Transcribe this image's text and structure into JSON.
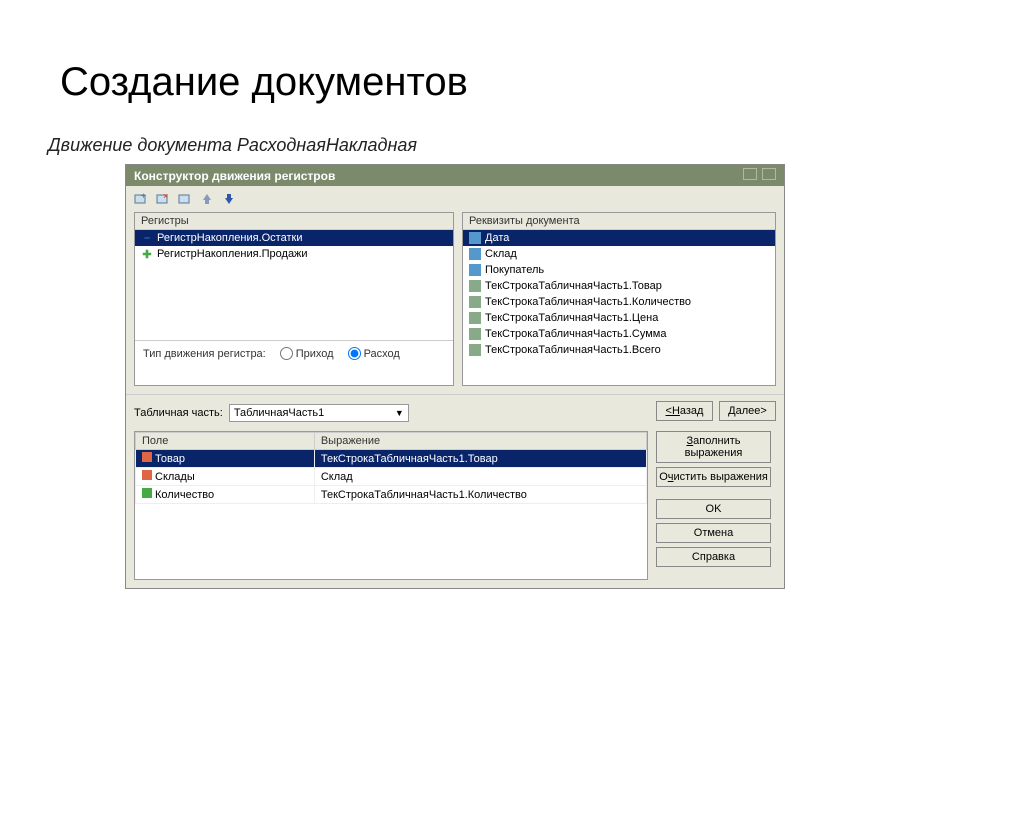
{
  "slide": {
    "title": "Создание документов",
    "subtitle": "Движение документа РасходнаяНакладная"
  },
  "window": {
    "title": "Конструктор движения регистров"
  },
  "registers": {
    "header": "Регистры",
    "items": [
      {
        "label": "РегистрНакопления.Остатки",
        "selected": true,
        "type": "minus"
      },
      {
        "label": "РегистрНакопления.Продажи",
        "selected": false,
        "type": "plus"
      }
    ]
  },
  "attrs": {
    "header": "Реквизиты документа",
    "items": [
      {
        "label": "Дата",
        "selected": true,
        "icon": "prop"
      },
      {
        "label": "Склад",
        "icon": "prop"
      },
      {
        "label": "Покупатель",
        "icon": "prop"
      },
      {
        "label": "ТекСтрокаТабличнаяЧасть1.Товар",
        "icon": "row"
      },
      {
        "label": "ТекСтрокаТабличнаяЧасть1.Количество",
        "icon": "row"
      },
      {
        "label": "ТекСтрокаТабличнаяЧасть1.Цена",
        "icon": "row"
      },
      {
        "label": "ТекСтрокаТабличнаяЧасть1.Сумма",
        "icon": "row"
      },
      {
        "label": "ТекСтрокаТабличнаяЧасть1.Всего",
        "icon": "row"
      }
    ]
  },
  "movement": {
    "label": "Тип движения регистра:",
    "option1": "Приход",
    "option2": "Расход",
    "selected": "Расход"
  },
  "tablepart": {
    "label": "Табличная часть:",
    "value": "ТабличнаяЧасть1"
  },
  "table": {
    "col1": "Поле",
    "col2": "Выражение",
    "rows": [
      {
        "field": "Товар",
        "expr": "ТекСтрокаТабличнаяЧасть1.Товар",
        "selected": true,
        "icon": "t1"
      },
      {
        "field": "Склады",
        "expr": "Склад",
        "icon": "t2"
      },
      {
        "field": "Количество",
        "expr": "ТекСтрокаТабличнаяЧасть1.Количество",
        "icon": "t3"
      }
    ]
  },
  "buttons": {
    "back": "<Назад",
    "next": "Далее>",
    "fill": "Заполнить выражения",
    "clear": "Очистить выражения",
    "ok": "OK",
    "cancel": "Отмена",
    "help": "Справка"
  }
}
